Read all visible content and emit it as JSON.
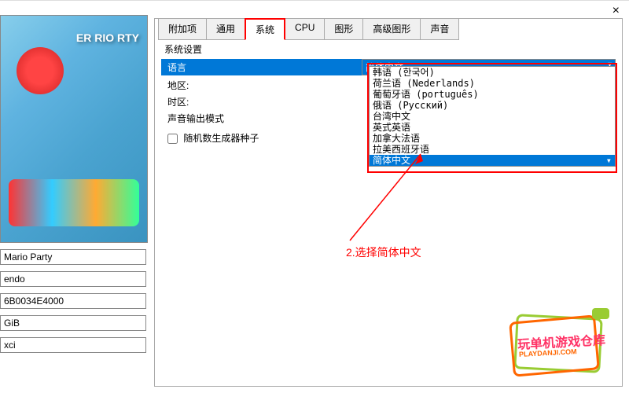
{
  "close": "×",
  "gameOverlay": "ER\nRIO\nRTY",
  "info": {
    "title": "Mario Party",
    "publisher": "endo",
    "id": "6B0034E4000",
    "size": "GiB",
    "format": "xci"
  },
  "tabs": [
    "附加项",
    "通用",
    "系统",
    "CPU",
    "图形",
    "高级图形",
    "声音"
  ],
  "activeTab": 2,
  "section": "系统设置",
  "rows": {
    "language": "语言",
    "region": "地区:",
    "timezone": "时区:",
    "audioMode": "声音输出模式"
  },
  "selectedLanguage": "简体中文",
  "checkbox": "随机数生成器种子",
  "options": [
    "韩语 (한국어)",
    "荷兰语 (Nederlands)",
    "葡萄牙语 (português)",
    "俄语 (Русский)",
    "台湾中文",
    "英式英语",
    "加拿大法语",
    "拉美西班牙语",
    "简体中文"
  ],
  "selectedOption": 8,
  "annotation": "2.选择简体中文",
  "logo": {
    "main": "玩单机游戏仓库",
    "sub": "PLAYDANJI.COM"
  }
}
